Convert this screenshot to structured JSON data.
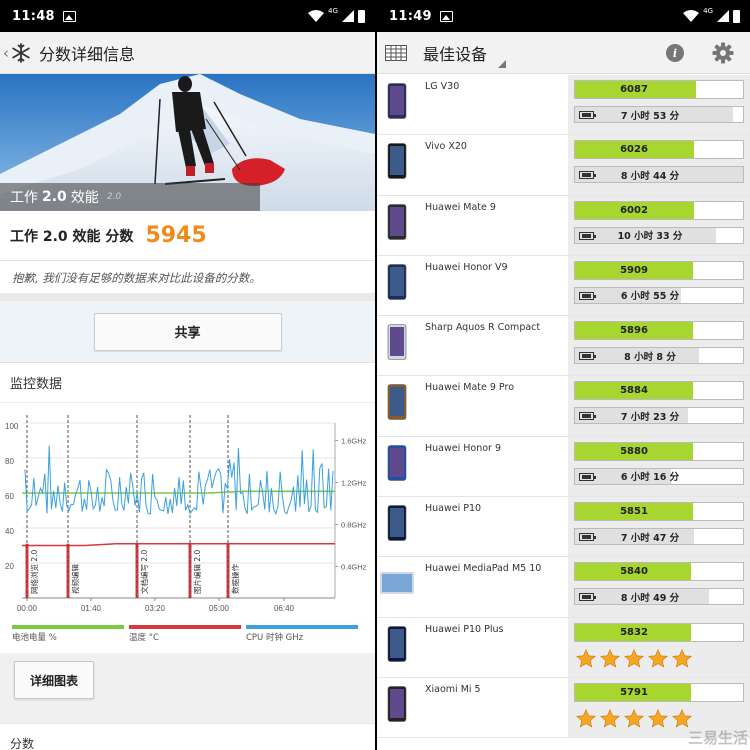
{
  "left": {
    "status": {
      "time": "11:48"
    },
    "appbar": {
      "back": "‹",
      "title": "分数详细信息"
    },
    "hero": {
      "label_a": "工作",
      "label_b": "2.0",
      "label_c": "效能",
      "label_version": "2.0"
    },
    "score": {
      "label": "工作 2.0 效能 分数",
      "value": "5945"
    },
    "note": "抱歉, 我们没有足够的数据来对比此设备的分数。",
    "share_label": "共享",
    "monitor_title": "监控数据",
    "chart_data": {
      "type": "line",
      "x_ticks": [
        "00:00",
        "01:40",
        "03:20",
        "05:00",
        "06:40"
      ],
      "y_left_ticks": [
        "100",
        "80",
        "60",
        "40",
        "20"
      ],
      "y_right_ticks": [
        "1.6GHz",
        "1.2GHz",
        "0.8GHz",
        "0.4GHz"
      ],
      "ylim": [
        0,
        100
      ],
      "series": [
        {
          "name": "电池电量 %",
          "color": "#7ac943",
          "values": [
            60,
            60,
            60,
            60,
            60,
            60,
            60,
            61,
            61,
            61,
            61
          ]
        },
        {
          "name": "温度 °C",
          "color": "#d9383a",
          "values": [
            30,
            30,
            30,
            31,
            31,
            31,
            31,
            31,
            31,
            31,
            31
          ]
        },
        {
          "name": "CPU 时钟 GHz",
          "color": "#3aa0e0"
        }
      ],
      "annotations": [
        "网络浏览 2.0",
        "视频编辑",
        "文档编写 2.0",
        "图片编辑 2.0",
        "数据操作"
      ],
      "grid": true
    },
    "detail_label": "详细图表",
    "bottom_title": "分数"
  },
  "right": {
    "status": {
      "time": "11:49"
    },
    "appbar": {
      "title": "最佳设备"
    },
    "devices": [
      {
        "name": "LG V30",
        "score": "6087",
        "score_frac": 0.72,
        "battery": "7 小时 53 分",
        "battery_frac": 0.94
      },
      {
        "name": "Vivo X20",
        "score": "6026",
        "score_frac": 0.71,
        "battery": "8 小时 44 分",
        "battery_frac": 1.0
      },
      {
        "name": "Huawei Mate 9",
        "score": "6002",
        "score_frac": 0.71,
        "battery": "10 小时 33 分",
        "battery_frac": 0.84
      },
      {
        "name": "Huawei Honor V9",
        "score": "5909",
        "score_frac": 0.7,
        "battery": "6 小时 55 分",
        "battery_frac": 0.63
      },
      {
        "name": "Sharp Aquos R Compact",
        "score": "5896",
        "score_frac": 0.7,
        "battery": "8 小时 8 分",
        "battery_frac": 0.74
      },
      {
        "name": "Huawei Mate 9 Pro",
        "score": "5884",
        "score_frac": 0.7,
        "battery": "7 小时 23 分",
        "battery_frac": 0.67
      },
      {
        "name": "Huawei Honor 9",
        "score": "5880",
        "score_frac": 0.7,
        "battery": "6 小时 16 分",
        "battery_frac": 0.57
      },
      {
        "name": "Huawei P10",
        "score": "5851",
        "score_frac": 0.7,
        "battery": "7 小时 47 分",
        "battery_frac": 0.71
      },
      {
        "name": "Huawei MediaPad M5 10",
        "score": "5840",
        "score_frac": 0.69,
        "battery": "8 小时 49 分",
        "battery_frac": 0.8
      },
      {
        "name": "Huawei P10 Plus",
        "score": "5832",
        "score_frac": 0.69,
        "rating": 5
      },
      {
        "name": "Xiaomi Mi 5",
        "score": "5791",
        "score_frac": 0.69,
        "rating": 5
      }
    ]
  }
}
